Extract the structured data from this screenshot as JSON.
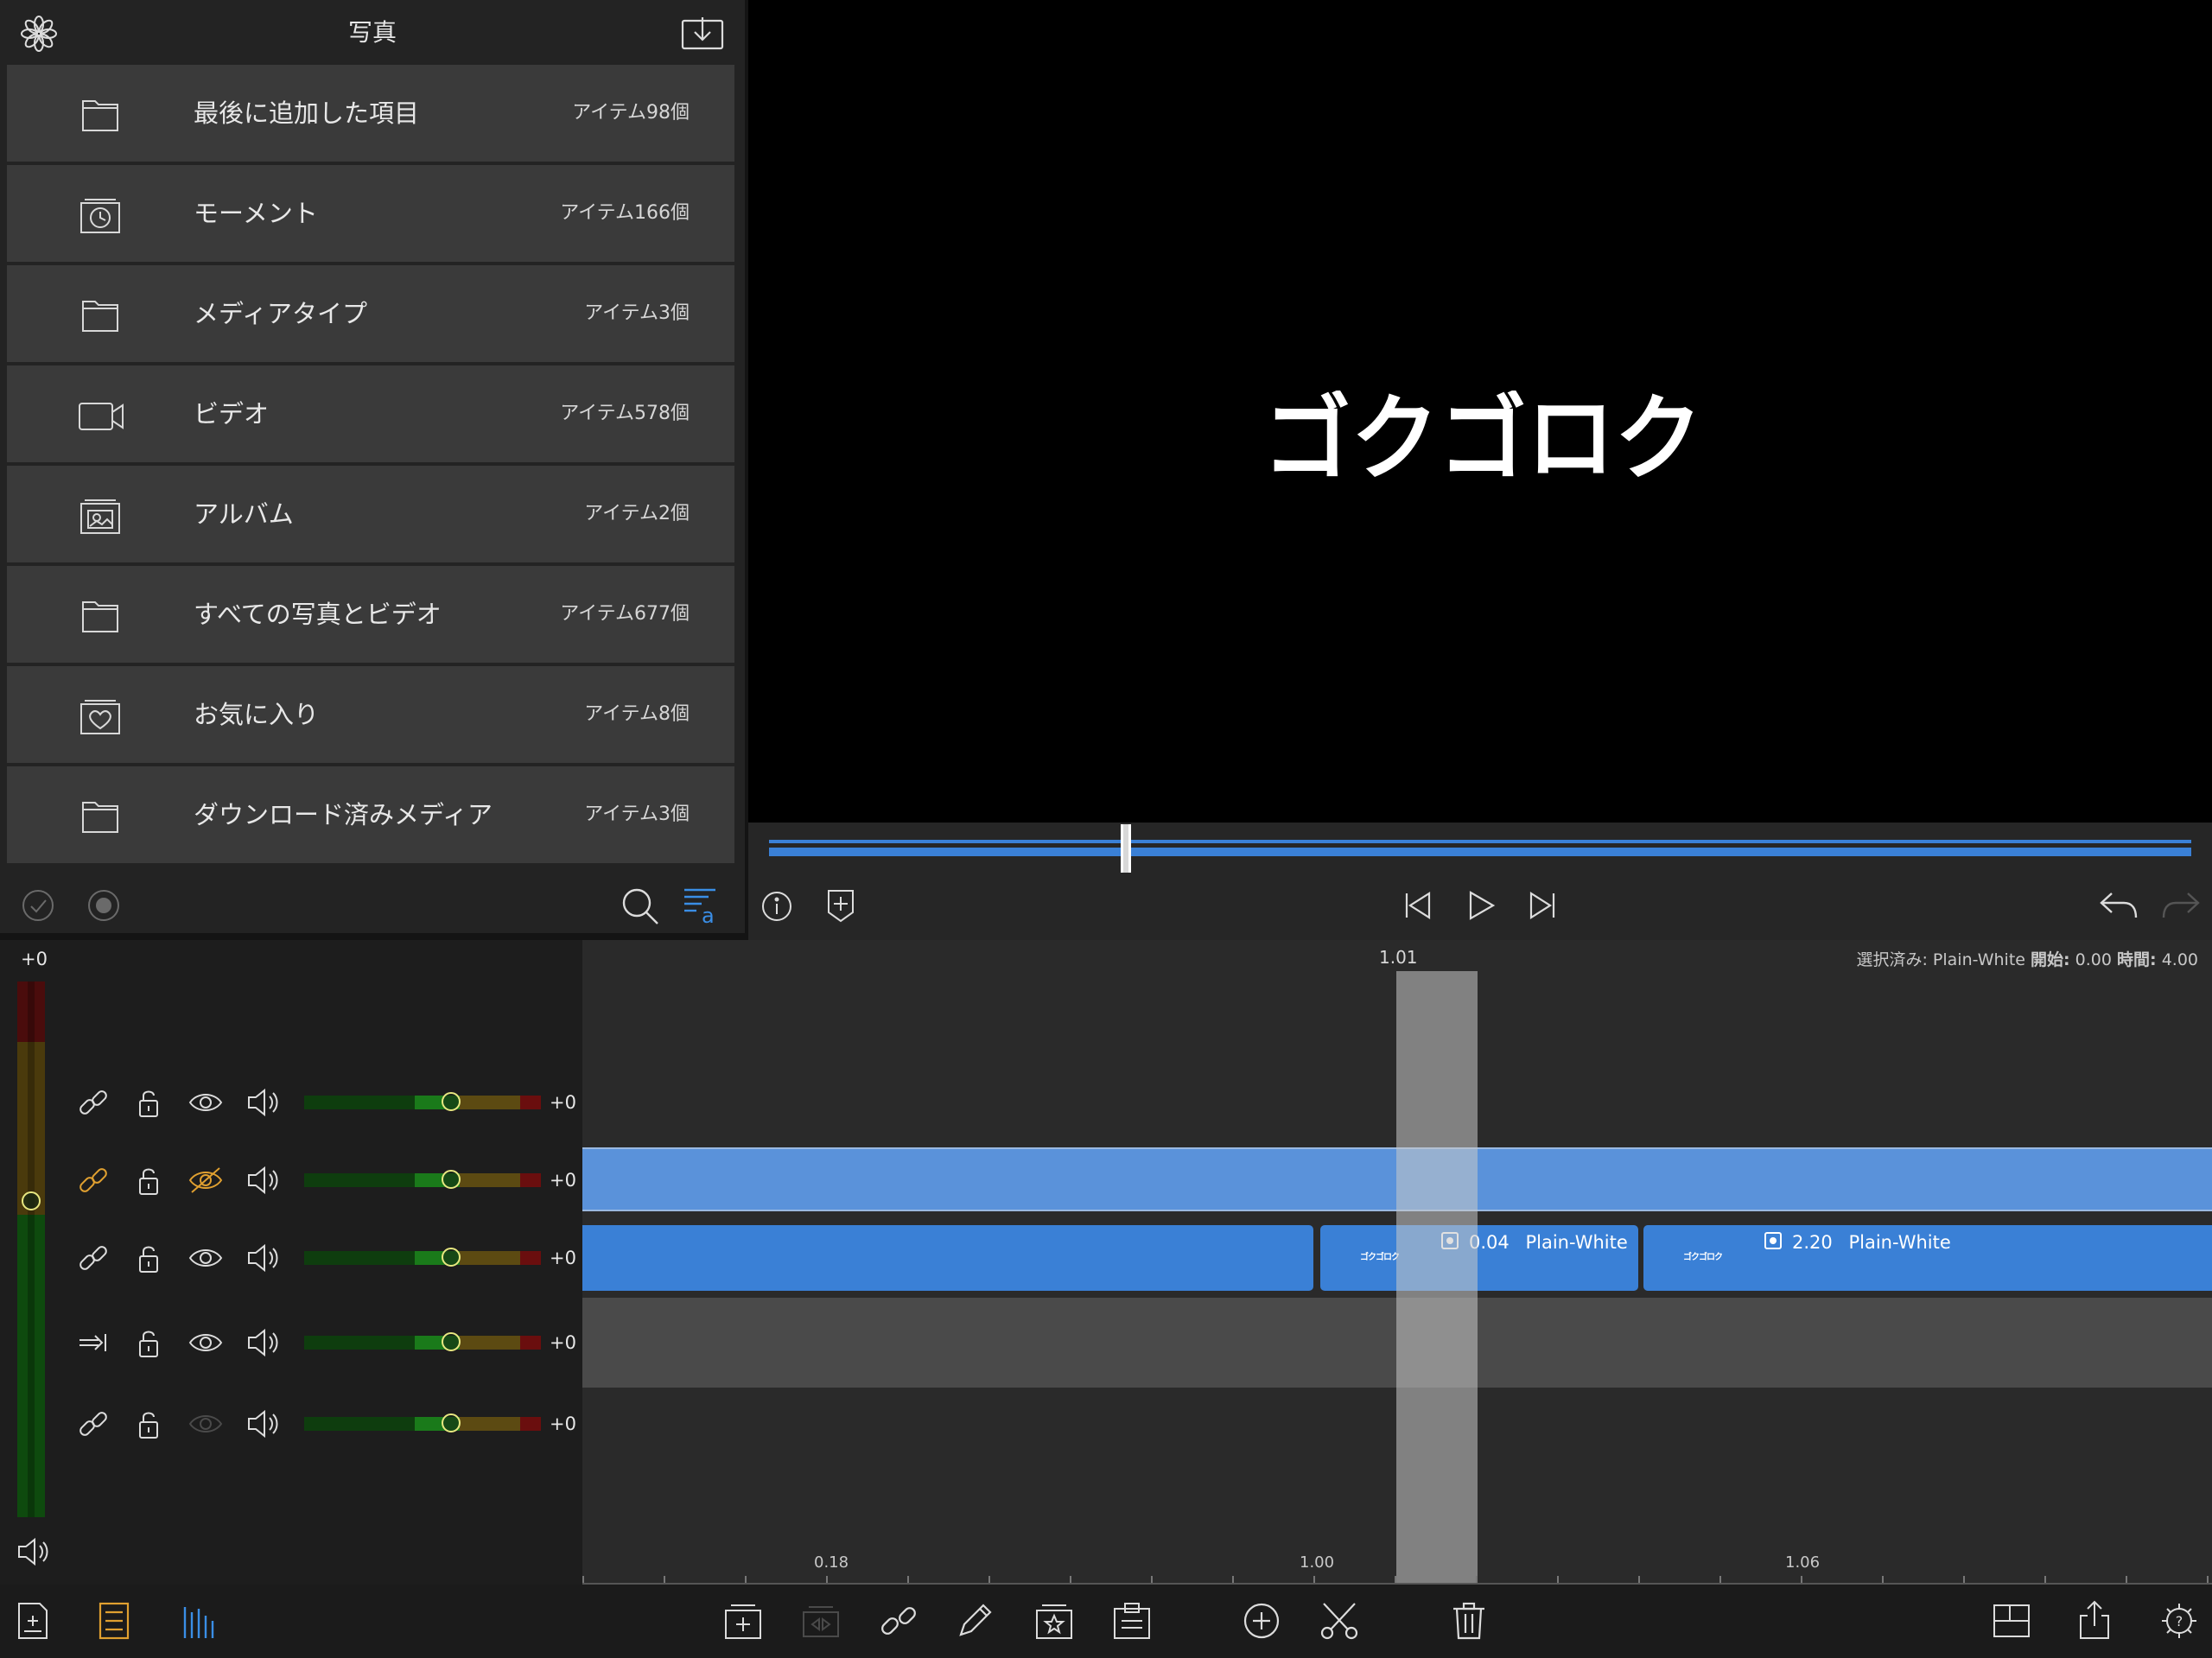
{
  "browser": {
    "title": "写真",
    "items": [
      {
        "label": "最後に追加した項目",
        "count": "アイテム98個",
        "icon": "folder-icon"
      },
      {
        "label": "モーメント",
        "count": "アイテム166個",
        "icon": "moments-icon"
      },
      {
        "label": "メディアタイプ",
        "count": "アイテム3個",
        "icon": "folder-icon"
      },
      {
        "label": "ビデオ",
        "count": "アイテム578個",
        "icon": "video-camera-icon"
      },
      {
        "label": "アルバム",
        "count": "アイテム2個",
        "icon": "album-icon"
      },
      {
        "label": "すべての写真とビデオ",
        "count": "アイテム677個",
        "icon": "folder-icon"
      },
      {
        "label": "お気に入り",
        "count": "アイテム8個",
        "icon": "favorites-icon"
      },
      {
        "label": "ダウンロード済みメディア",
        "count": "アイテム3個",
        "icon": "folder-icon"
      }
    ]
  },
  "viewer": {
    "title_text": "ゴクゴロク",
    "playhead_fraction": 0.251
  },
  "mixer": {
    "master_value": "+0",
    "master_level_fraction": 0.41,
    "tracks": [
      {
        "value": "+0",
        "link": "link-icon",
        "linked_active": false,
        "visible": "eye-icon",
        "fader_fraction": 0.62
      },
      {
        "value": "+0",
        "link": "link-icon",
        "linked_active": true,
        "visible": "eye-slash-icon",
        "fader_fraction": 0.62
      },
      {
        "value": "+0",
        "link": "link-icon",
        "linked_active": false,
        "visible": "eye-icon",
        "fader_fraction": 0.62
      },
      {
        "value": "+0",
        "link": "arrow-to-end-icon",
        "linked_active": false,
        "visible": "eye-icon",
        "fader_fraction": 0.62
      },
      {
        "value": "+0",
        "link": "link-icon",
        "linked_active": false,
        "visible": "eye-dim-icon",
        "fader_fraction": 0.62
      }
    ]
  },
  "timeline": {
    "top_value": "1.01",
    "status": {
      "selected_label": "選択済み:",
      "selected_value": "Plain-White",
      "start_label": "開始:",
      "start_value": "0.00",
      "duration_label": "時間:",
      "duration_value": "4.00"
    },
    "clips": [
      {
        "time": "0.04",
        "name": "Plain-White",
        "thumb": "ゴクゴロク"
      },
      {
        "time": "2.20",
        "name": "Plain-White",
        "thumb": "ゴクゴロク"
      }
    ],
    "ruler": [
      "0.18",
      "1.00",
      "1.06"
    ]
  },
  "colors": {
    "accent_blue": "#3a80d6",
    "active_orange": "#e0a030",
    "viewer_bg": "#000000"
  }
}
